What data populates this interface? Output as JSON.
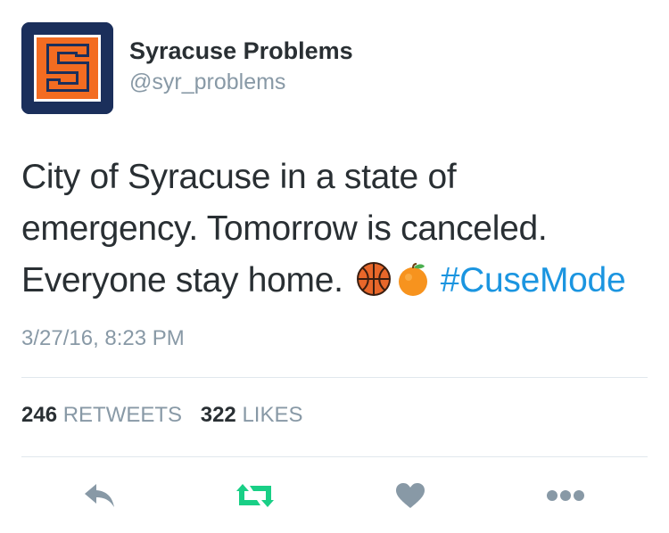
{
  "profile": {
    "display_name": "Syracuse Problems",
    "handle": "@syr_problems",
    "avatar_letter": "S"
  },
  "tweet": {
    "line1": "City of Syracuse in a state of",
    "line2": "emergency. Tomorrow is canceled.",
    "line3_text": "Everyone stay home.",
    "emojis": [
      "basketball-icon",
      "orange-icon"
    ],
    "hashtag": "#CuseMode",
    "timestamp": "3/27/16, 8:23 PM"
  },
  "stats": {
    "retweets_count": "246",
    "retweets_label": "RETWEETS",
    "likes_count": "322",
    "likes_label": "LIKES"
  },
  "actions": [
    "reply-icon",
    "retweet-icon",
    "like-icon",
    "more-icon"
  ],
  "colors": {
    "hashtag": "#1b95e0",
    "retweet_active": "#19cf86",
    "icon_gray": "#8899a6",
    "avatar_bg": "#1b2f5b",
    "avatar_orange": "#f36c21"
  }
}
